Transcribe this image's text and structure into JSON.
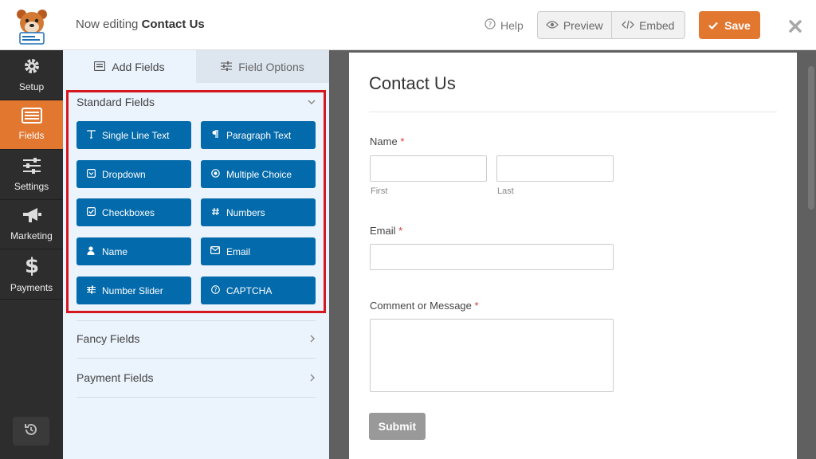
{
  "header": {
    "editing_prefix": "Now editing",
    "form_name": "Contact Us",
    "help_label": "Help",
    "preview_label": "Preview",
    "embed_label": "Embed",
    "save_label": "Save"
  },
  "sidebar": {
    "items": [
      {
        "label": "Setup",
        "icon": "gear-icon"
      },
      {
        "label": "Fields",
        "icon": "fields-icon"
      },
      {
        "label": "Settings",
        "icon": "sliders-icon"
      },
      {
        "label": "Marketing",
        "icon": "megaphone-icon"
      },
      {
        "label": "Payments",
        "icon": "dollar-icon"
      }
    ]
  },
  "panel": {
    "tabs": [
      {
        "label": "Add Fields"
      },
      {
        "label": "Field Options"
      }
    ],
    "standard": {
      "title": "Standard Fields",
      "fields": [
        {
          "label": "Single Line Text",
          "icon": "text-icon"
        },
        {
          "label": "Paragraph Text",
          "icon": "paragraph-icon"
        },
        {
          "label": "Dropdown",
          "icon": "dropdown-icon"
        },
        {
          "label": "Multiple Choice",
          "icon": "radio-icon"
        },
        {
          "label": "Checkboxes",
          "icon": "checkbox-icon"
        },
        {
          "label": "Numbers",
          "icon": "hash-icon"
        },
        {
          "label": "Name",
          "icon": "user-icon"
        },
        {
          "label": "Email",
          "icon": "envelope-icon"
        },
        {
          "label": "Number Slider",
          "icon": "slider-icon"
        },
        {
          "label": "CAPTCHA",
          "icon": "question-icon"
        }
      ]
    },
    "fancy_title": "Fancy Fields",
    "payment_title": "Payment Fields"
  },
  "form": {
    "title": "Contact Us",
    "name_label": "Name",
    "first_label": "First",
    "last_label": "Last",
    "email_label": "Email",
    "message_label": "Comment or Message",
    "required_mark": "*",
    "submit_label": "Submit"
  }
}
